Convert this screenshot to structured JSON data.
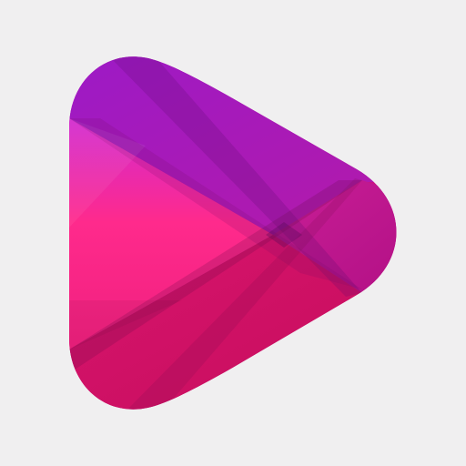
{
  "app_icon": {
    "icon": "play-icon",
    "colors": {
      "background": "#f0eff0",
      "purple_top": "#a21bc4",
      "magenta": "#e0157e",
      "pink_center": "#ff2a8c",
      "crimson_bottom": "#c40d5a"
    }
  }
}
